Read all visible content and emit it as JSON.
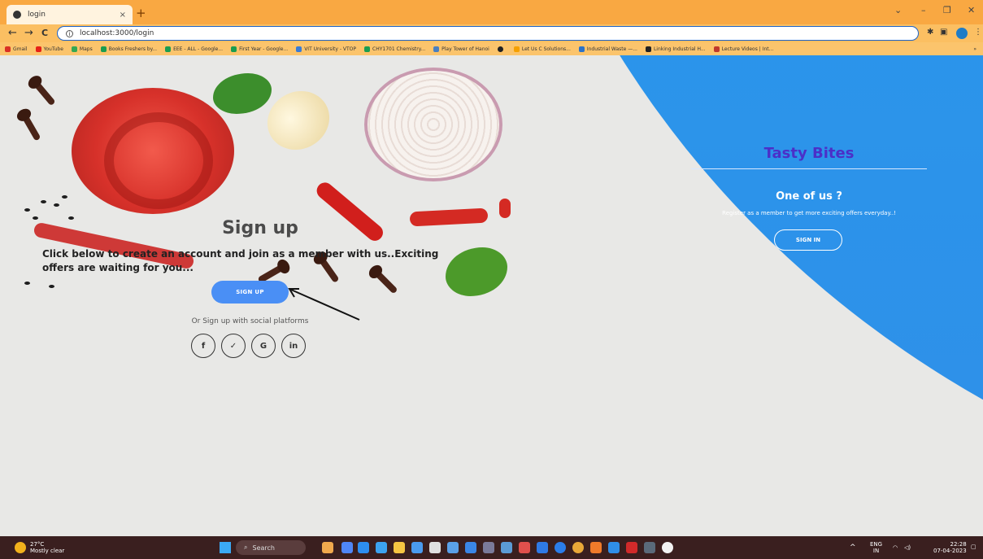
{
  "browser": {
    "tab_title": "login",
    "tab_close": "×",
    "new_tab": "+",
    "url": "localhost:3000/login",
    "window_controls": [
      "⌄",
      "–",
      "❐",
      "✕"
    ],
    "nav": {
      "back": "←",
      "forward": "→",
      "reload": "C"
    },
    "bookmarks": [
      "Gmail",
      "YouTube",
      "Maps",
      "Books Freshers by...",
      "EEE - ALL - Google...",
      "First Year - Google...",
      "VIT University - VTOP",
      "CHY1701 Chemistry...",
      "Play Tower of Hanoi",
      "",
      "Let Us C Solutions...",
      "Industrial Waste —...",
      "Linking Industrial H...",
      "Lecture Videos | Int..."
    ],
    "more_bookmarks": "»"
  },
  "signup": {
    "title": "Sign up",
    "description": "Click below to create an account and join as a member with us..Exciting offers are waiting for you...",
    "button_label": "SIGN UP",
    "social_text": "Or Sign up with social platforms",
    "social_icons": [
      "f",
      "✓",
      "G",
      "in"
    ]
  },
  "panel": {
    "brand": "Tasty Bites",
    "heading": "One of us ?",
    "text": "Register as a member to get more exciting offers everyday..!",
    "signin_label": "SIGN IN"
  },
  "taskbar": {
    "temperature": "27°C",
    "weather": "Mostly clear",
    "search_label": "Search",
    "lang1": "ENG",
    "lang2": "IN",
    "time": "22:28",
    "date": "07-04-2023"
  }
}
